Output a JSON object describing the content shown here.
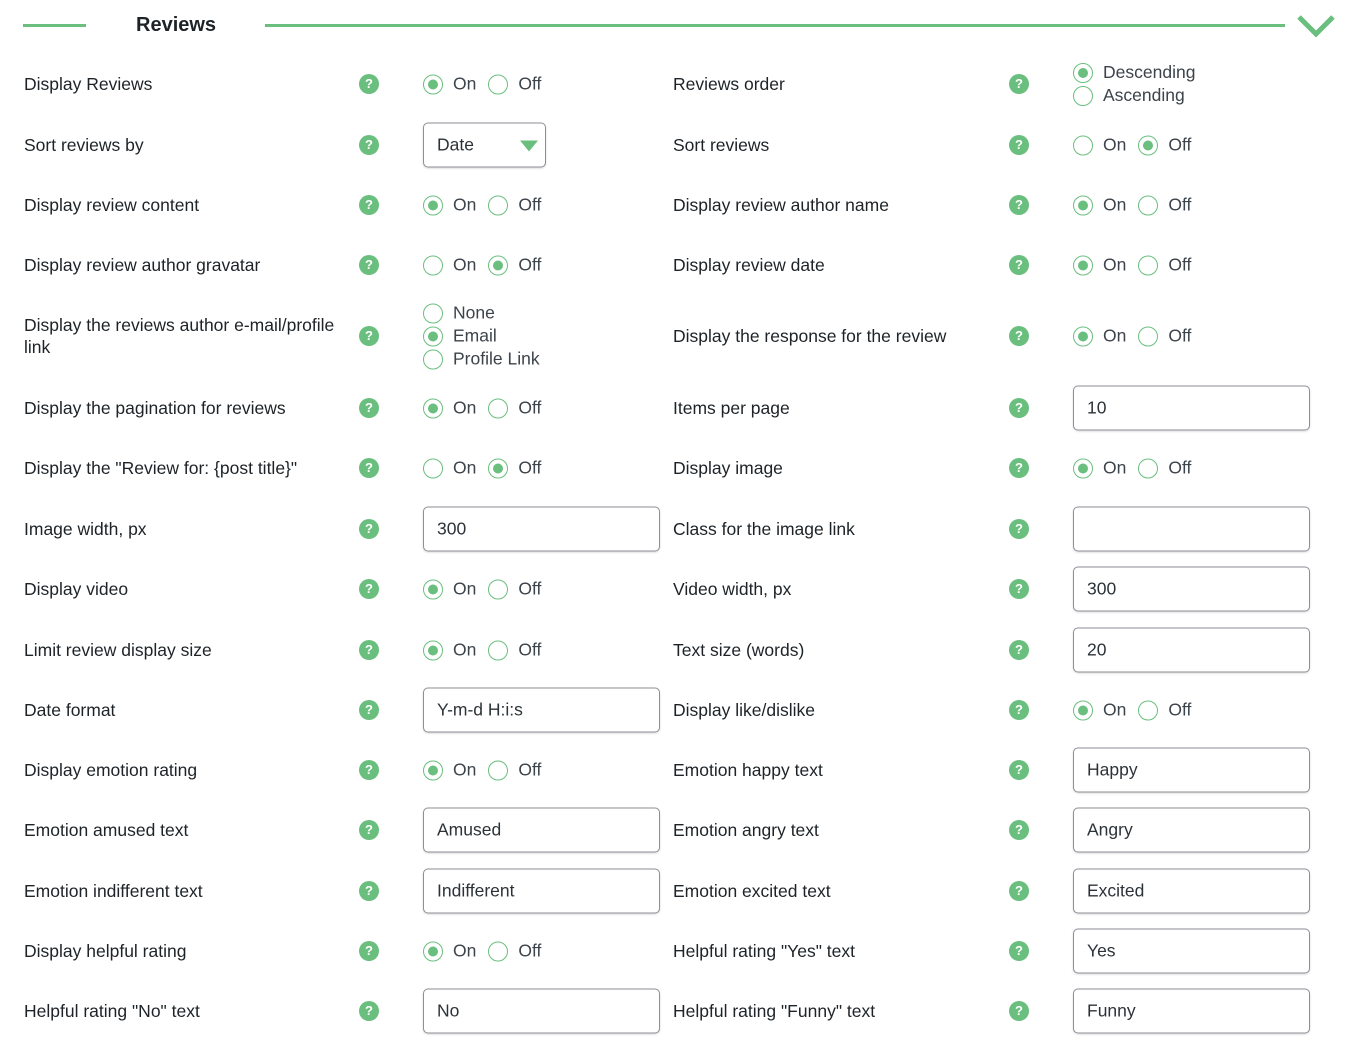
{
  "section": {
    "title": "Reviews",
    "collapse_icon": "chevron-down-icon",
    "accent_color": "#6abf7f"
  },
  "help_icon_glyph": "?",
  "left": [
    {
      "key": "display_reviews",
      "label": "Display Reviews",
      "type": "radio-inline",
      "options": [
        "On",
        "Off"
      ],
      "selected": "On"
    },
    {
      "key": "sort_reviews_by",
      "label": "Sort reviews by",
      "type": "select",
      "value": "Date"
    },
    {
      "key": "display_review_content",
      "label": "Display review content",
      "type": "radio-inline",
      "options": [
        "On",
        "Off"
      ],
      "selected": "On"
    },
    {
      "key": "display_review_author_gravatar",
      "label": "Display review author gravatar",
      "type": "radio-inline",
      "options": [
        "On",
        "Off"
      ],
      "selected": "Off"
    },
    {
      "key": "display_author_email_profile",
      "label": "Display the reviews author e-mail/profile link",
      "type": "radio-stack",
      "options": [
        "None",
        "Email",
        "Profile Link"
      ],
      "selected": "Email"
    },
    {
      "key": "display_pagination",
      "label": "Display the pagination for reviews",
      "type": "radio-inline",
      "options": [
        "On",
        "Off"
      ],
      "selected": "On"
    },
    {
      "key": "display_review_for",
      "label": "Display the \"Review for: {post title}\"",
      "type": "radio-inline",
      "options": [
        "On",
        "Off"
      ],
      "selected": "Off"
    },
    {
      "key": "image_width",
      "label": "Image width, px",
      "type": "text",
      "value": "300"
    },
    {
      "key": "display_video",
      "label": "Display video",
      "type": "radio-inline",
      "options": [
        "On",
        "Off"
      ],
      "selected": "On"
    },
    {
      "key": "limit_review_display_size",
      "label": "Limit review display size",
      "type": "radio-inline",
      "options": [
        "On",
        "Off"
      ],
      "selected": "On"
    },
    {
      "key": "date_format",
      "label": "Date format",
      "type": "text",
      "value": "Y-m-d H:i:s"
    },
    {
      "key": "display_emotion_rating",
      "label": "Display emotion rating",
      "type": "radio-inline",
      "options": [
        "On",
        "Off"
      ],
      "selected": "On"
    },
    {
      "key": "emotion_amused_text",
      "label": "Emotion amused text",
      "type": "text",
      "value": "Amused"
    },
    {
      "key": "emotion_indifferent_text",
      "label": "Emotion indifferent text",
      "type": "text",
      "value": "Indifferent"
    },
    {
      "key": "display_helpful_rating",
      "label": "Display helpful rating",
      "type": "radio-inline",
      "options": [
        "On",
        "Off"
      ],
      "selected": "On"
    },
    {
      "key": "helpful_no_text",
      "label": "Helpful rating \"No\" text",
      "type": "text",
      "value": "No"
    }
  ],
  "right": [
    {
      "key": "reviews_order",
      "label": "Reviews order",
      "type": "radio-stack",
      "options": [
        "Descending",
        "Ascending"
      ],
      "selected": "Descending"
    },
    {
      "key": "sort_reviews",
      "label": "Sort reviews",
      "type": "radio-inline",
      "options": [
        "On",
        "Off"
      ],
      "selected": "Off"
    },
    {
      "key": "display_review_author_name",
      "label": "Display review author name",
      "type": "radio-inline",
      "options": [
        "On",
        "Off"
      ],
      "selected": "On"
    },
    {
      "key": "display_review_date",
      "label": "Display review date",
      "type": "radio-inline",
      "options": [
        "On",
        "Off"
      ],
      "selected": "On"
    },
    {
      "key": "display_response",
      "label": "Display the response for the review",
      "type": "radio-inline",
      "options": [
        "On",
        "Off"
      ],
      "selected": "On"
    },
    {
      "key": "items_per_page",
      "label": "Items per page",
      "type": "text",
      "value": "10"
    },
    {
      "key": "display_image",
      "label": "Display image",
      "type": "radio-inline",
      "options": [
        "On",
        "Off"
      ],
      "selected": "On"
    },
    {
      "key": "class_image_link",
      "label": "Class for the image link",
      "type": "text",
      "value": ""
    },
    {
      "key": "video_width",
      "label": "Video width, px",
      "type": "text",
      "value": "300"
    },
    {
      "key": "text_size_words",
      "label": "Text size (words)",
      "type": "text",
      "value": "20"
    },
    {
      "key": "display_like_dislike",
      "label": "Display like/dislike",
      "type": "radio-inline",
      "options": [
        "On",
        "Off"
      ],
      "selected": "On"
    },
    {
      "key": "emotion_happy_text",
      "label": "Emotion happy text",
      "type": "text",
      "value": "Happy"
    },
    {
      "key": "emotion_angry_text",
      "label": "Emotion angry text",
      "type": "text",
      "value": "Angry"
    },
    {
      "key": "emotion_excited_text",
      "label": "Emotion excited text",
      "type": "text",
      "value": "Excited"
    },
    {
      "key": "helpful_yes_text",
      "label": "Helpful rating \"Yes\" text",
      "type": "text",
      "value": "Yes"
    },
    {
      "key": "helpful_funny_text",
      "label": "Helpful rating \"Funny\" text",
      "type": "text",
      "value": "Funny"
    }
  ]
}
